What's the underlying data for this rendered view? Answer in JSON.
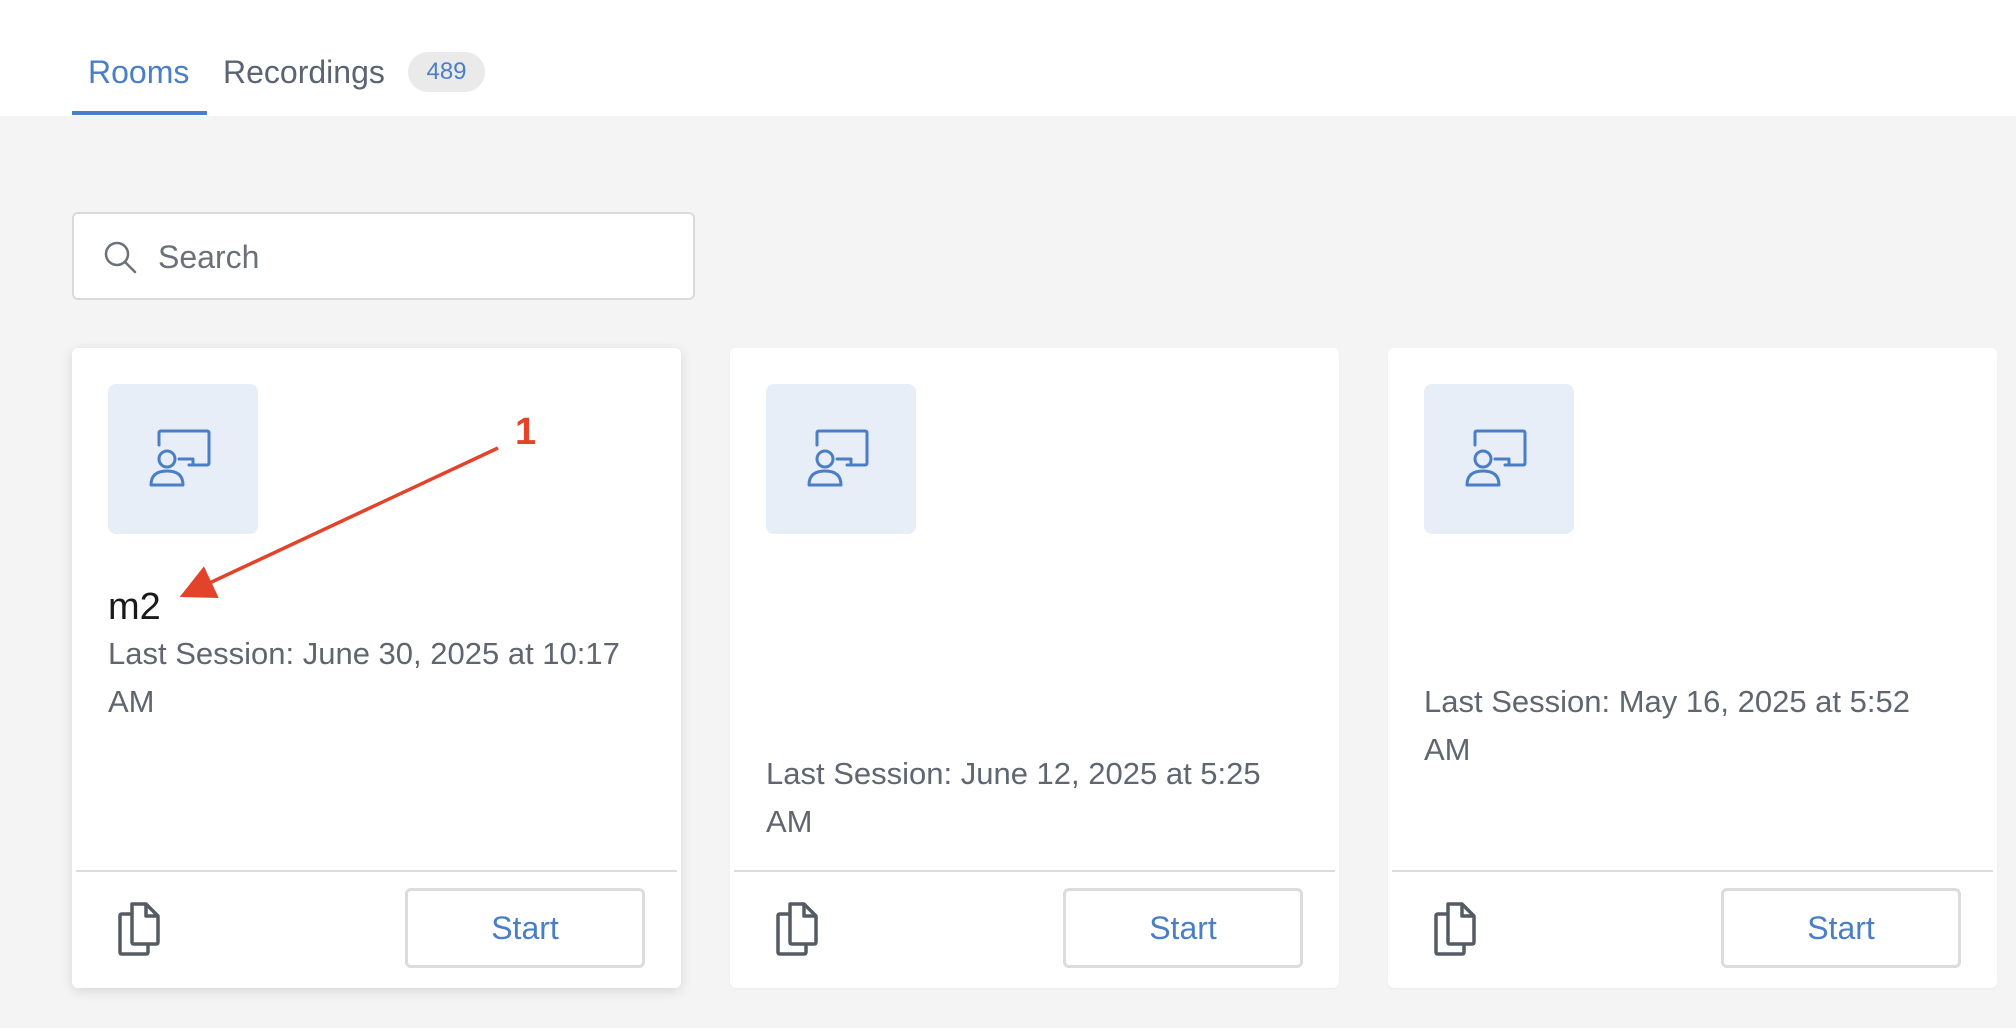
{
  "tabs": {
    "rooms_label": "Rooms",
    "recordings_label": "Recordings",
    "recordings_count": "489"
  },
  "search": {
    "placeholder": "Search"
  },
  "rooms": [
    {
      "name": "m2",
      "last_session": "Last Session: June 30, 2025 at 10:17 AM",
      "start_label": "Start"
    },
    {
      "name": "",
      "last_session": "Last Session: June 12, 2025 at 5:25 AM",
      "start_label": "Start"
    },
    {
      "name": "",
      "last_session": "Last Session: May 16, 2025 at 5:52 AM",
      "start_label": "Start"
    }
  ],
  "annotation": {
    "label": "1"
  },
  "colors": {
    "accent": "#4a7ec7",
    "annotation": "#e2432a",
    "background": "#f4f4f4"
  }
}
